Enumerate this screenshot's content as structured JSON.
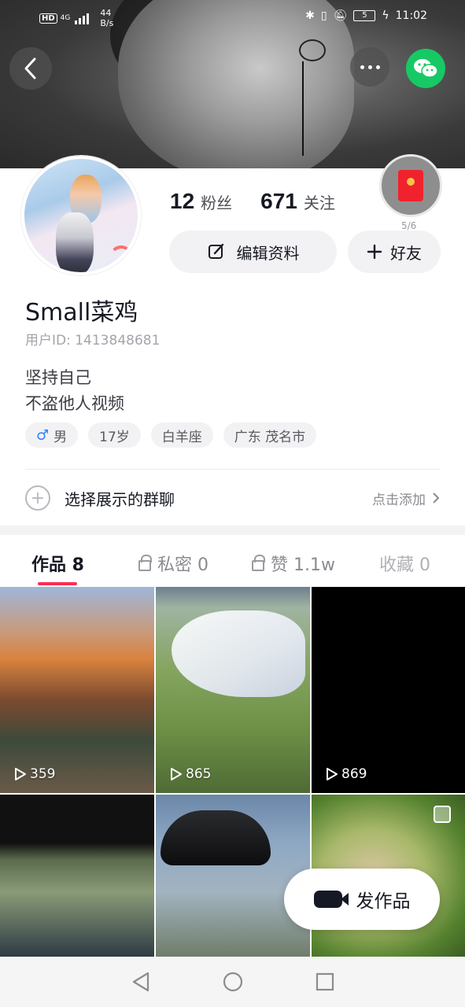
{
  "status_bar": {
    "network_badge": "HD",
    "network_type": "4G",
    "speed_value": "44",
    "speed_unit": "B/s",
    "battery": "5",
    "time": "11:02"
  },
  "profile": {
    "followers_count": "12",
    "followers_label": "粉丝",
    "following_count": "671",
    "following_label": "关注",
    "red_packet_progress": "5/6",
    "edit_button_label": "编辑资料",
    "add_friend_label": "好友",
    "username": "Small菜鸡",
    "user_id": "用户ID: 1413848681",
    "bio_lines": [
      "坚持自己",
      "不盗他人视频"
    ],
    "tags": {
      "gender": "男",
      "age": "17岁",
      "zodiac": "白羊座",
      "location": "广东 茂名市"
    },
    "group_chat_label": "选择展示的群聊",
    "group_chat_action": "点击添加"
  },
  "tabs": [
    {
      "label": "作品 8",
      "locked": false,
      "active": true
    },
    {
      "label": "私密 0",
      "locked": true,
      "active": false
    },
    {
      "label": "赞 1.1w",
      "locked": true,
      "active": false
    },
    {
      "label": "收藏 0",
      "locked": false,
      "active": false
    }
  ],
  "videos": [
    {
      "plays": "359"
    },
    {
      "plays": "865"
    },
    {
      "plays": "869"
    },
    {
      "plays": ""
    },
    {
      "plays": ""
    },
    {
      "plays": ""
    }
  ],
  "post_button_label": "发作品",
  "colors": {
    "accent": "#fe2c55",
    "wechat": "#17c964",
    "red_packet": "#f0222d",
    "male": "#2f7fff"
  },
  "icons": {
    "back": "chevron-left-icon",
    "more": "more-dots-icon",
    "wechat": "wechat-icon",
    "edit": "edit-icon",
    "add": "plus-icon",
    "lock": "lock-icon",
    "play": "play-icon",
    "camera": "camera-icon"
  }
}
